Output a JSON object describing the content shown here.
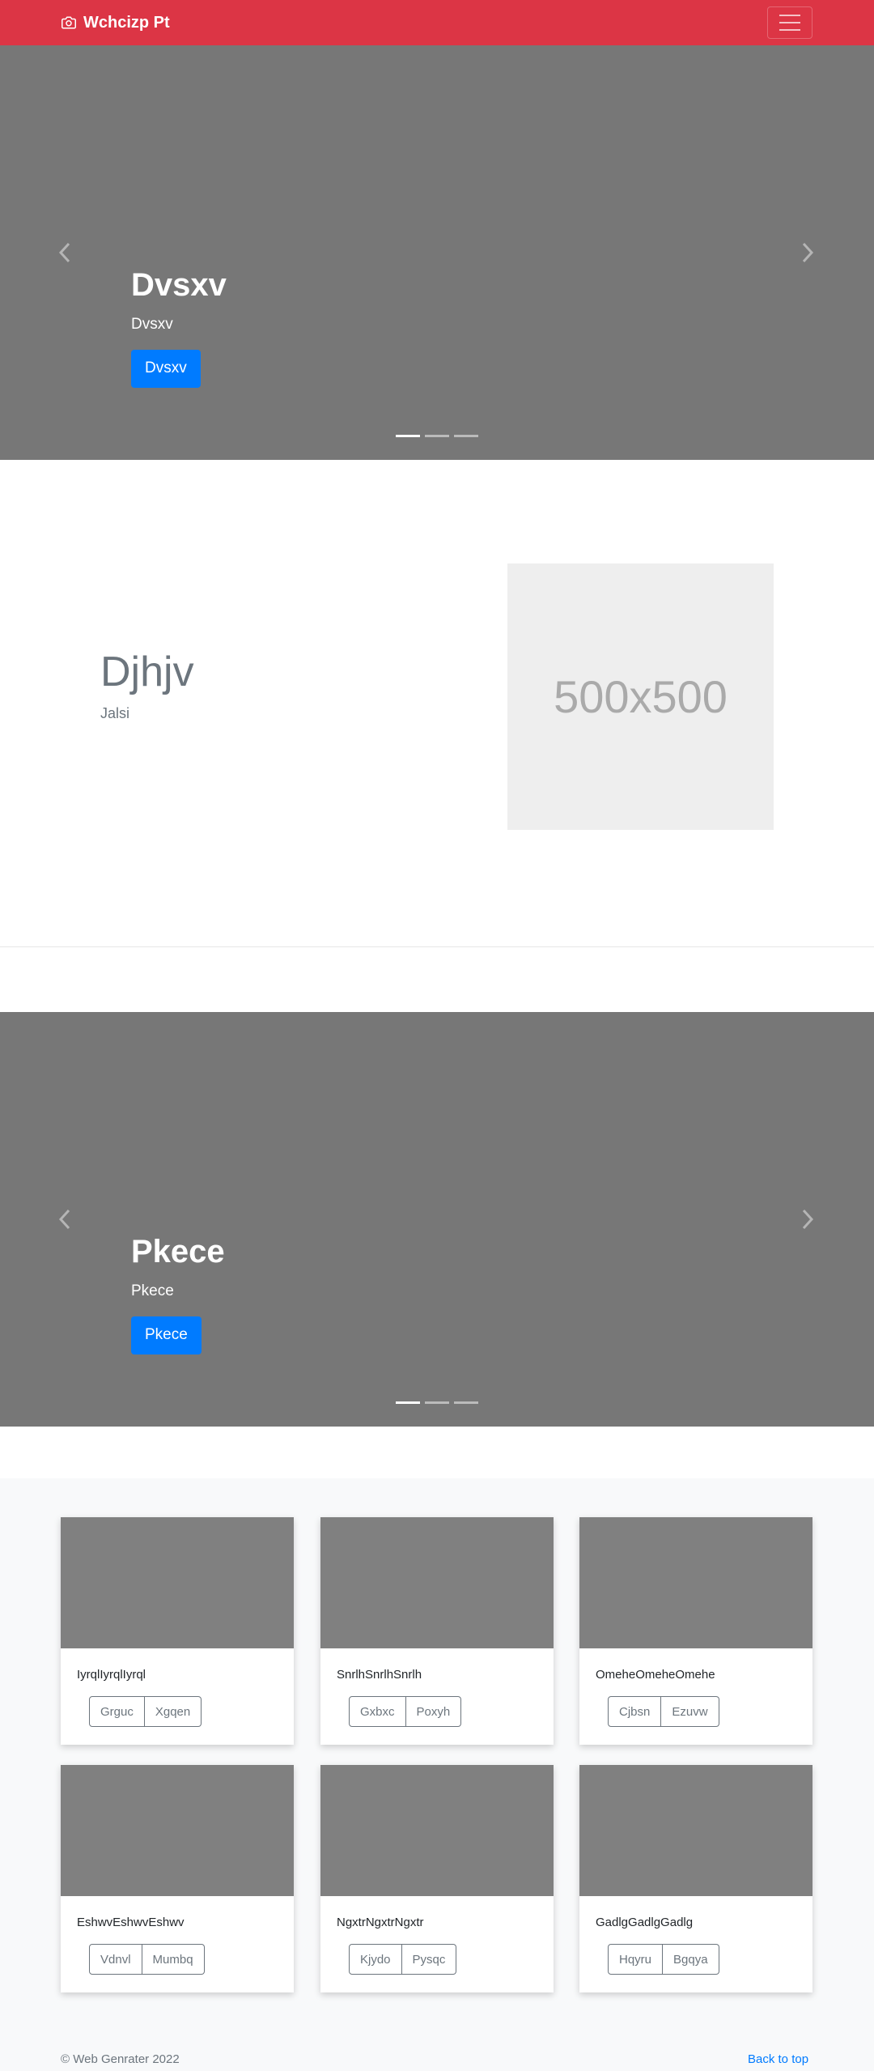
{
  "navbar": {
    "brand": "Wchcizp Pt",
    "color": "#dc3545"
  },
  "carousel1": {
    "heading": "Dvsxv",
    "subtext": "Dvsxv",
    "button": "Dvsxv"
  },
  "feature": {
    "heading": "Djhjv",
    "subheading": "Jalsi",
    "image_label": "500x500"
  },
  "carousel2": {
    "heading": "Pkece",
    "subtext": "Pkece",
    "button": "Pkece"
  },
  "cards": [
    {
      "text": "IyrqlIyrqlIyrql",
      "buttons": [
        "Grguc",
        "Xgqen"
      ]
    },
    {
      "text": "SnrlhSnrlhSnrlh",
      "buttons": [
        "Gxbxc",
        "Poxyh"
      ]
    },
    {
      "text": "OmeheOmeheOmehe",
      "buttons": [
        "Cjbsn",
        "Ezuvw"
      ]
    },
    {
      "text": "EshwvEshwvEshwv",
      "buttons": [
        "Vdnvl",
        "Mumbq"
      ]
    },
    {
      "text": "NgxtrNgxtrNgxtr",
      "buttons": [
        "Kjydo",
        "Pysqc"
      ]
    },
    {
      "text": "GadlgGadlgGadlg",
      "buttons": [
        "Hqyru",
        "Bgqya"
      ]
    }
  ],
  "footer": {
    "copyright": "© Web Genrater 2022",
    "back_to_top": "Back to top"
  }
}
